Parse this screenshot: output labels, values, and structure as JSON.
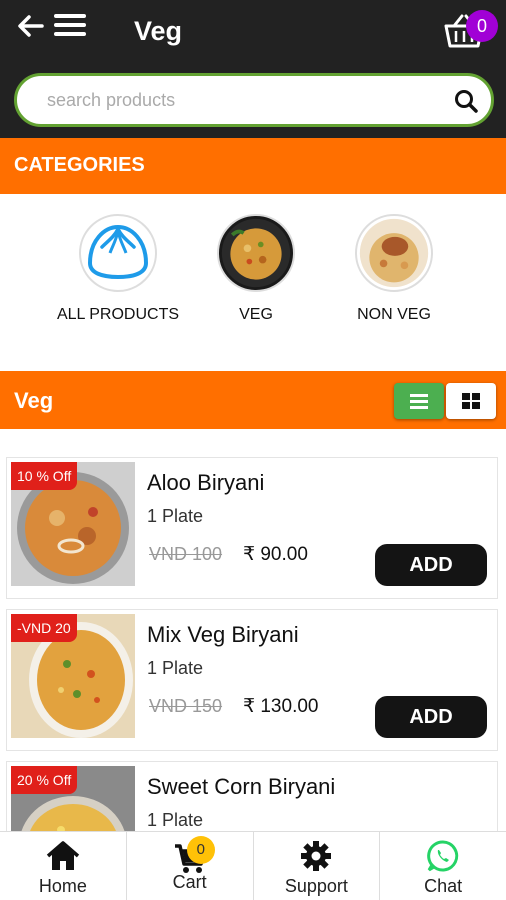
{
  "header": {
    "title": "Veg",
    "cart_count": "0"
  },
  "search": {
    "placeholder": "search products"
  },
  "categories": {
    "heading": "CATEGORIES",
    "items": [
      {
        "label": "ALL PRODUCTS"
      },
      {
        "label": "VEG"
      },
      {
        "label": "NON VEG"
      }
    ]
  },
  "section": {
    "title": "Veg"
  },
  "products": [
    {
      "discount": "10 % Off",
      "name": "Aloo Biryani",
      "qty": "1 Plate",
      "old_price": "VND 100",
      "price": "₹ 90.00",
      "button": "ADD"
    },
    {
      "discount": "-VND 20",
      "name": "Mix Veg Biryani",
      "qty": "1 Plate",
      "old_price": "VND 150",
      "price": "₹ 130.00",
      "button": "ADD"
    },
    {
      "discount": "20 % Off",
      "name": "Sweet Corn Biryani",
      "qty": "1 Plate",
      "old_price": "",
      "price": "",
      "button": ""
    }
  ],
  "bottom_nav": {
    "home": "Home",
    "cart": "Cart",
    "cart_count": "0",
    "support": "Support",
    "chat": "Chat"
  },
  "colors": {
    "header": "#222222",
    "accent": "#ff6f00",
    "search_border": "#63a232",
    "badge": "#a100d6",
    "discount": "#e0201a",
    "whatsapp": "#25d366"
  }
}
